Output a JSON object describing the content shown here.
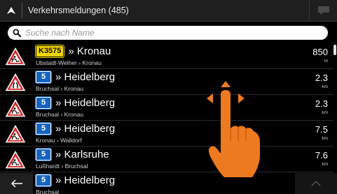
{
  "header": {
    "title": "Verkehrsmeldungen (485)",
    "nav_icon": "navigation-arrow-icon",
    "chat_icon": "chat-bubble-icon"
  },
  "search": {
    "placeholder": "Suche nach Name",
    "value": ""
  },
  "items": [
    {
      "road": "K3575",
      "road_type": "state",
      "destination": "» Kronau",
      "route": "Ubstadt-Weiher › Kronau",
      "distance": "850",
      "unit": "m",
      "icon": "roadworks-warning-icon"
    },
    {
      "road": "5",
      "road_type": "federal",
      "destination": "» Heidelberg",
      "route": "Bruchsal › Kronau",
      "distance": "2.3",
      "unit": "km",
      "icon": "road-narrows-warning-icon"
    },
    {
      "road": "5",
      "road_type": "federal",
      "destination": "» Heidelberg",
      "route": "Bruchsal › Kronau",
      "distance": "2.3",
      "unit": "km",
      "icon": "roadworks-warning-icon"
    },
    {
      "road": "5",
      "road_type": "federal",
      "destination": "» Heidelberg",
      "route": "Kronau › Walldorf",
      "distance": "7.5",
      "unit": "km",
      "icon": "roadworks-warning-icon"
    },
    {
      "road": "5",
      "road_type": "federal",
      "destination": "» Karlsruhe",
      "route": "Lußhardt › Bruchsal",
      "distance": "7.6",
      "unit": "km",
      "icon": "roadworks-warning-icon"
    },
    {
      "road": "5",
      "road_type": "federal",
      "destination": "» Heidelberg",
      "route": "Bruchsal",
      "distance": "",
      "unit": "",
      "icon": "roadworks-warning-icon"
    }
  ],
  "footer": {
    "back_icon": "back-arrow-icon",
    "up_icon": "chevron-up-icon"
  },
  "colors": {
    "state_road": "#f2d400",
    "federal_road": "#1565c0",
    "warning_red": "#d62020",
    "hand_orange": "#ee7a1f"
  }
}
